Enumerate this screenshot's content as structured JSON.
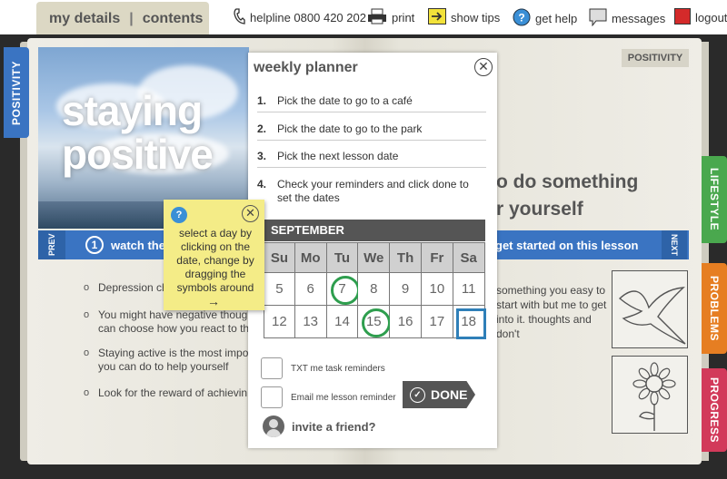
{
  "nav": {
    "my_details": "my details",
    "separator": "|",
    "contents": "contents"
  },
  "toolbar": {
    "helpline": "helpline 0800 420 202",
    "print": "print",
    "show_tips": "show tips",
    "get_help": "get help",
    "messages": "messages",
    "logout": "logout"
  },
  "hero": {
    "title_line1": "staying",
    "title_line2": "positive"
  },
  "side_tabs": {
    "positivity": "POSITIVITY",
    "lifestyle": "LIFESTYLE",
    "problems": "PROBLEMS",
    "progress": "PROGRESS"
  },
  "lesson_bar": {
    "prev": "PREV",
    "next": "NEXT",
    "step": "1",
    "watch": "watch the",
    "get_started": "get started on this lesson"
  },
  "left_list": [
    "Depression ch",
    "You might have negative though can choose how you react to th",
    "Staying active is the most impo you can do to help yourself",
    "Look for the reward of achievin"
  ],
  "right_page": {
    "tag": "POSITIVITY",
    "heading_line1": "o do something",
    "heading_line2": "r yourself",
    "body": "something you easy to start with but me to get into it. thoughts and don't"
  },
  "planner": {
    "title": "weekly planner",
    "close_icon": "close-icon",
    "tasks": [
      {
        "num": "1.",
        "text": "Pick the date to go to a café"
      },
      {
        "num": "2.",
        "text": "Pick the date to go to the park"
      },
      {
        "num": "3.",
        "text": "Pick the next lesson date"
      },
      {
        "num": "4.",
        "text": "Check your reminders and click done to set the dates"
      }
    ],
    "month": "SEPTEMBER",
    "weekdays": [
      "Su",
      "Mo",
      "Tu",
      "We",
      "Th",
      "Fr",
      "Sa"
    ],
    "week1": [
      "5",
      "6",
      "7",
      "8",
      "9",
      "10",
      "11"
    ],
    "week2": [
      "12",
      "13",
      "14",
      "15",
      "16",
      "17",
      "18"
    ],
    "txt_reminder": "TXT me task reminders",
    "email_reminder": "Email me lesson reminder",
    "done": "DONE",
    "invite": "invite a friend?"
  },
  "sticky": {
    "help": "?",
    "text": "select a day by clicking on the date, change by dragging the symbols around",
    "arrow": "→"
  }
}
